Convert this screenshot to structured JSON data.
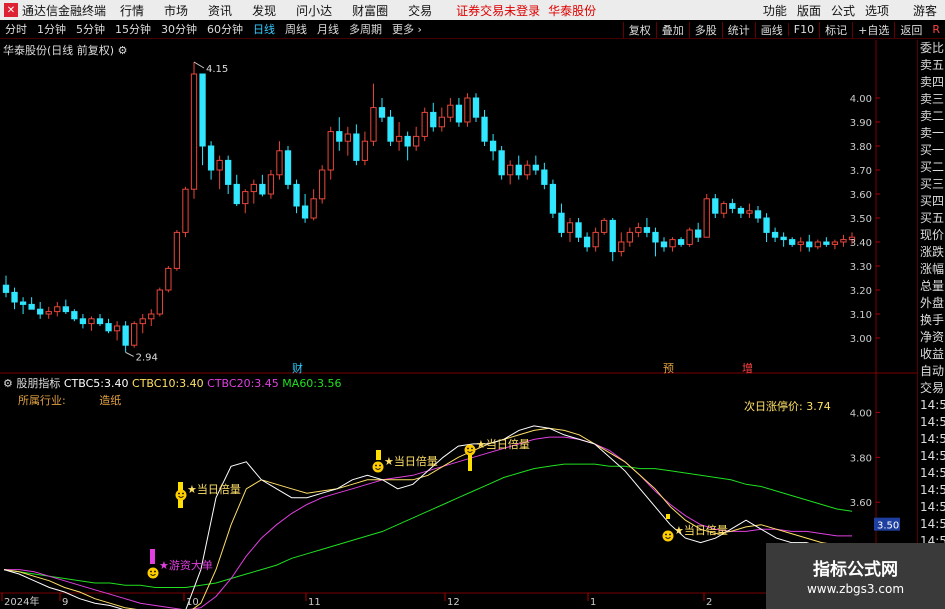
{
  "menubar": {
    "app_title": "通达信金融终端",
    "items": [
      "行情",
      "市场",
      "资讯",
      "发现",
      "问小达",
      "财富圈",
      "交易"
    ],
    "status": "证券交易未登录",
    "stock_name": "华泰股份",
    "right_items": [
      "功能",
      "版面",
      "公式",
      "选项"
    ],
    "guest": "游客"
  },
  "toolbar": {
    "periods": [
      "分时",
      "1分钟",
      "5分钟",
      "15分钟",
      "30分钟",
      "60分钟",
      "日线",
      "周线",
      "月线",
      "多周期",
      "更多"
    ],
    "active_period": "日线",
    "right_buttons": [
      "复权",
      "叠加",
      "多股",
      "统计",
      "画线",
      "F10",
      "标记",
      "+自选",
      "返回"
    ],
    "r_label": "R"
  },
  "main_chart": {
    "title": "华泰股份(日线 前复权)",
    "high_label": "4.15",
    "low_label": "2.94",
    "price_ticks": [
      "4.00",
      "3.90",
      "3.80",
      "3.70",
      "3.60",
      "3.50",
      "3.40",
      "3.30",
      "3.20",
      "3.10",
      "3.00"
    ],
    "markers": [
      "财",
      "预",
      "增"
    ]
  },
  "indicator": {
    "name": "股朋指标",
    "ctbc5_label": "CTBC5:",
    "ctbc5_value": "3.40",
    "ctbc10_label": "CTBC10:",
    "ctbc10_value": "3.40",
    "ctbc20_label": "CTBC20:",
    "ctbc20_value": "3.45",
    "ma60_label": "MA60:",
    "ma60_value": "3.56",
    "industry_label": "所属行业:",
    "industry_value": "造纸",
    "limit_price_label": "次日涨停价:",
    "limit_price_value": "3.74",
    "ticks": [
      "4.00",
      "3.80",
      "3.60",
      "3.40"
    ],
    "current_value": "3.50",
    "annotations": [
      "★游资大单",
      "★当日倍量",
      "★当日倍量",
      "★当日倍量",
      "★当日倍量"
    ]
  },
  "x_axis": [
    "2024年",
    "9",
    "10",
    "11",
    "12",
    "1",
    "2"
  ],
  "sidebar": [
    "委比",
    "卖五",
    "卖四",
    "卖三",
    "卖二",
    "卖一",
    "买一",
    "买二",
    "买三",
    "买四",
    "买五",
    "现价",
    "涨跌",
    "涨幅",
    "总量",
    "外盘",
    "换手",
    "净资",
    "收益",
    "自动",
    "交易",
    "14:55",
    "14:56",
    "14:56",
    "14:56",
    "14:56",
    "14:56",
    "14:56",
    "14:56",
    "14:56"
  ],
  "watermark": {
    "line1": "指标公式网",
    "line2": "www.zbgs3.com"
  },
  "colors": {
    "up": "#e8473a",
    "down": "#31e6ff",
    "ctbc5": "#ffffff",
    "ctbc10": "#ffe066",
    "ctbc20": "#e040e0",
    "ma60": "#20e020"
  },
  "chart_data": {
    "type": "candlestick",
    "price_range": [
      2.9,
      4.2
    ],
    "candles": [
      [
        3.22,
        3.26,
        3.17,
        3.19
      ],
      [
        3.19,
        3.21,
        3.12,
        3.15
      ],
      [
        3.15,
        3.17,
        3.1,
        3.14
      ],
      [
        3.14,
        3.17,
        3.12,
        3.12
      ],
      [
        3.12,
        3.15,
        3.08,
        3.1
      ],
      [
        3.1,
        3.13,
        3.08,
        3.11
      ],
      [
        3.11,
        3.15,
        3.09,
        3.13
      ],
      [
        3.13,
        3.16,
        3.1,
        3.11
      ],
      [
        3.11,
        3.12,
        3.07,
        3.08
      ],
      [
        3.08,
        3.1,
        3.04,
        3.06
      ],
      [
        3.06,
        3.09,
        3.03,
        3.08
      ],
      [
        3.08,
        3.1,
        3.05,
        3.06
      ],
      [
        3.06,
        3.08,
        3.02,
        3.03
      ],
      [
        3.03,
        3.07,
        2.99,
        3.05
      ],
      [
        3.05,
        3.07,
        2.94,
        2.97
      ],
      [
        2.97,
        3.07,
        2.96,
        3.06
      ],
      [
        3.06,
        3.1,
        3.02,
        3.08
      ],
      [
        3.08,
        3.12,
        3.05,
        3.1
      ],
      [
        3.1,
        3.21,
        3.09,
        3.2
      ],
      [
        3.2,
        3.3,
        3.19,
        3.29
      ],
      [
        3.29,
        3.45,
        3.28,
        3.44
      ],
      [
        3.44,
        3.63,
        3.42,
        3.62
      ],
      [
        3.62,
        4.15,
        3.58,
        4.1
      ],
      [
        4.1,
        4.1,
        3.72,
        3.8
      ],
      [
        3.8,
        3.82,
        3.66,
        3.7
      ],
      [
        3.7,
        3.76,
        3.62,
        3.74
      ],
      [
        3.74,
        3.76,
        3.6,
        3.64
      ],
      [
        3.64,
        3.68,
        3.55,
        3.56
      ],
      [
        3.56,
        3.62,
        3.52,
        3.61
      ],
      [
        3.61,
        3.66,
        3.56,
        3.64
      ],
      [
        3.64,
        3.68,
        3.59,
        3.6
      ],
      [
        3.6,
        3.7,
        3.58,
        3.68
      ],
      [
        3.68,
        3.82,
        3.66,
        3.78
      ],
      [
        3.78,
        3.8,
        3.62,
        3.64
      ],
      [
        3.64,
        3.66,
        3.52,
        3.55
      ],
      [
        3.55,
        3.6,
        3.48,
        3.5
      ],
      [
        3.5,
        3.62,
        3.49,
        3.58
      ],
      [
        3.58,
        3.72,
        3.56,
        3.7
      ],
      [
        3.7,
        3.88,
        3.66,
        3.86
      ],
      [
        3.86,
        3.92,
        3.78,
        3.82
      ],
      [
        3.82,
        3.88,
        3.76,
        3.85
      ],
      [
        3.85,
        3.89,
        3.72,
        3.74
      ],
      [
        3.74,
        3.86,
        3.72,
        3.82
      ],
      [
        3.82,
        4.06,
        3.8,
        3.96
      ],
      [
        3.96,
        4.0,
        3.9,
        3.92
      ],
      [
        3.92,
        3.95,
        3.8,
        3.82
      ],
      [
        3.82,
        3.9,
        3.78,
        3.84
      ],
      [
        3.84,
        3.86,
        3.74,
        3.8
      ],
      [
        3.8,
        3.88,
        3.78,
        3.84
      ],
      [
        3.84,
        3.96,
        3.82,
        3.94
      ],
      [
        3.94,
        3.98,
        3.86,
        3.88
      ],
      [
        3.88,
        3.96,
        3.86,
        3.92
      ],
      [
        3.92,
        4.0,
        3.9,
        3.97
      ],
      [
        3.97,
        4.0,
        3.88,
        3.9
      ],
      [
        3.9,
        4.02,
        3.88,
        4.0
      ],
      [
        4.0,
        4.02,
        3.9,
        3.92
      ],
      [
        3.92,
        3.95,
        3.8,
        3.82
      ],
      [
        3.82,
        3.85,
        3.74,
        3.78
      ],
      [
        3.78,
        3.8,
        3.66,
        3.68
      ],
      [
        3.68,
        3.74,
        3.64,
        3.72
      ],
      [
        3.72,
        3.76,
        3.66,
        3.68
      ],
      [
        3.68,
        3.74,
        3.66,
        3.72
      ],
      [
        3.72,
        3.76,
        3.68,
        3.7
      ],
      [
        3.7,
        3.73,
        3.62,
        3.64
      ],
      [
        3.64,
        3.66,
        3.5,
        3.52
      ],
      [
        3.52,
        3.56,
        3.42,
        3.44
      ],
      [
        3.44,
        3.5,
        3.4,
        3.48
      ],
      [
        3.48,
        3.5,
        3.4,
        3.42
      ],
      [
        3.42,
        3.44,
        3.36,
        3.38
      ],
      [
        3.38,
        3.46,
        3.36,
        3.44
      ],
      [
        3.44,
        3.5,
        3.43,
        3.49
      ],
      [
        3.49,
        3.5,
        3.32,
        3.36
      ],
      [
        3.36,
        3.44,
        3.34,
        3.4
      ],
      [
        3.4,
        3.46,
        3.38,
        3.44
      ],
      [
        3.44,
        3.48,
        3.42,
        3.46
      ],
      [
        3.46,
        3.5,
        3.42,
        3.44
      ],
      [
        3.44,
        3.46,
        3.34,
        3.4
      ],
      [
        3.4,
        3.42,
        3.36,
        3.38
      ],
      [
        3.38,
        3.42,
        3.36,
        3.41
      ],
      [
        3.41,
        3.42,
        3.38,
        3.39
      ],
      [
        3.39,
        3.46,
        3.38,
        3.45
      ],
      [
        3.45,
        3.48,
        3.4,
        3.42
      ],
      [
        3.42,
        3.6,
        3.42,
        3.58
      ],
      [
        3.58,
        3.6,
        3.5,
        3.52
      ],
      [
        3.52,
        3.57,
        3.5,
        3.56
      ],
      [
        3.56,
        3.58,
        3.52,
        3.54
      ],
      [
        3.54,
        3.55,
        3.5,
        3.52
      ],
      [
        3.52,
        3.56,
        3.5,
        3.53
      ],
      [
        3.53,
        3.55,
        3.48,
        3.5
      ],
      [
        3.5,
        3.52,
        3.4,
        3.44
      ],
      [
        3.44,
        3.46,
        3.4,
        3.42
      ],
      [
        3.42,
        3.44,
        3.38,
        3.41
      ],
      [
        3.41,
        3.42,
        3.38,
        3.39
      ],
      [
        3.39,
        3.42,
        3.36,
        3.4
      ],
      [
        3.4,
        3.43,
        3.36,
        3.38
      ],
      [
        3.38,
        3.41,
        3.37,
        3.4
      ],
      [
        3.4,
        3.42,
        3.38,
        3.39
      ],
      [
        3.39,
        3.41,
        3.37,
        3.4
      ],
      [
        3.4,
        3.43,
        3.38,
        3.41
      ],
      [
        3.41,
        3.44,
        3.39,
        3.42
      ]
    ],
    "indicator_range": [
      3.2,
      4.1
    ],
    "ctbc5": [
      3.3,
      3.28,
      3.25,
      3.22,
      3.2,
      3.17,
      3.15,
      3.14,
      3.12,
      3.11,
      3.1,
      3.1,
      3.12,
      3.3,
      3.62,
      3.76,
      3.78,
      3.7,
      3.66,
      3.62,
      3.62,
      3.64,
      3.66,
      3.7,
      3.72,
      3.7,
      3.66,
      3.68,
      3.74,
      3.8,
      3.85,
      3.86,
      3.86,
      3.88,
      3.92,
      3.94,
      3.93,
      3.9,
      3.88,
      3.86,
      3.8,
      3.74,
      3.66,
      3.58,
      3.5,
      3.44,
      3.42,
      3.44,
      3.48,
      3.52,
      3.48,
      3.44,
      3.42,
      3.42,
      3.4,
      3.4,
      3.4
    ],
    "ctbc10": [
      3.3,
      3.29,
      3.27,
      3.25,
      3.22,
      3.2,
      3.17,
      3.15,
      3.13,
      3.12,
      3.11,
      3.1,
      3.1,
      3.15,
      3.3,
      3.5,
      3.66,
      3.7,
      3.68,
      3.66,
      3.64,
      3.65,
      3.66,
      3.68,
      3.7,
      3.7,
      3.7,
      3.7,
      3.72,
      3.76,
      3.8,
      3.83,
      3.86,
      3.88,
      3.9,
      3.92,
      3.93,
      3.92,
      3.9,
      3.86,
      3.82,
      3.78,
      3.72,
      3.66,
      3.58,
      3.52,
      3.48,
      3.46,
      3.47,
      3.49,
      3.5,
      3.48,
      3.46,
      3.44,
      3.42,
      3.41,
      3.4
    ],
    "ctbc20": [
      3.3,
      3.3,
      3.29,
      3.27,
      3.25,
      3.23,
      3.21,
      3.19,
      3.17,
      3.15,
      3.14,
      3.13,
      3.12,
      3.13,
      3.18,
      3.26,
      3.36,
      3.44,
      3.5,
      3.55,
      3.59,
      3.62,
      3.64,
      3.66,
      3.68,
      3.7,
      3.71,
      3.72,
      3.74,
      3.76,
      3.78,
      3.8,
      3.82,
      3.84,
      3.86,
      3.88,
      3.89,
      3.89,
      3.88,
      3.86,
      3.83,
      3.78,
      3.72,
      3.65,
      3.59,
      3.54,
      3.5,
      3.48,
      3.47,
      3.47,
      3.48,
      3.48,
      3.47,
      3.47,
      3.46,
      3.45,
      3.45
    ],
    "ma60": [
      3.3,
      3.29,
      3.28,
      3.27,
      3.26,
      3.25,
      3.24,
      3.24,
      3.23,
      3.23,
      3.22,
      3.22,
      3.22,
      3.23,
      3.24,
      3.26,
      3.28,
      3.3,
      3.32,
      3.35,
      3.37,
      3.39,
      3.41,
      3.43,
      3.45,
      3.47,
      3.5,
      3.53,
      3.56,
      3.59,
      3.62,
      3.65,
      3.68,
      3.71,
      3.73,
      3.75,
      3.76,
      3.77,
      3.77,
      3.77,
      3.76,
      3.76,
      3.75,
      3.75,
      3.74,
      3.73,
      3.72,
      3.71,
      3.7,
      3.68,
      3.67,
      3.65,
      3.63,
      3.61,
      3.59,
      3.57,
      3.56
    ]
  }
}
